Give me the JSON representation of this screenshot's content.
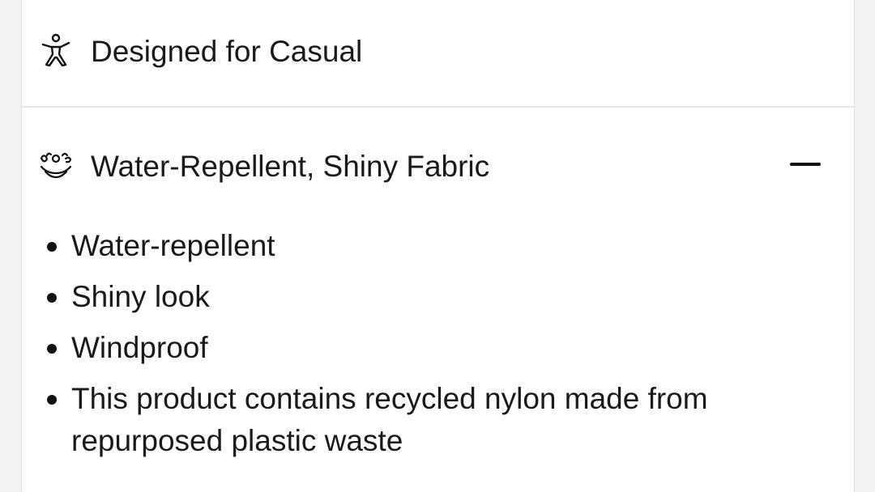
{
  "sections": [
    {
      "title": "Designed for Casual",
      "icon": "person-casual-icon",
      "expanded": false
    },
    {
      "title": "Water-Repellent, Shiny Fabric",
      "icon": "water-drops-fabric-icon",
      "expanded": true,
      "toggle_icon": "minus-icon",
      "details": [
        "Water-repellent",
        "Shiny look",
        "Windproof",
        "This product contains recycled nylon made from repurposed plastic waste"
      ]
    }
  ],
  "colors": {
    "text": "#1a1a1a",
    "divider": "#e6e6e6",
    "panel": "#ffffff",
    "background": "#f2f2f2"
  }
}
